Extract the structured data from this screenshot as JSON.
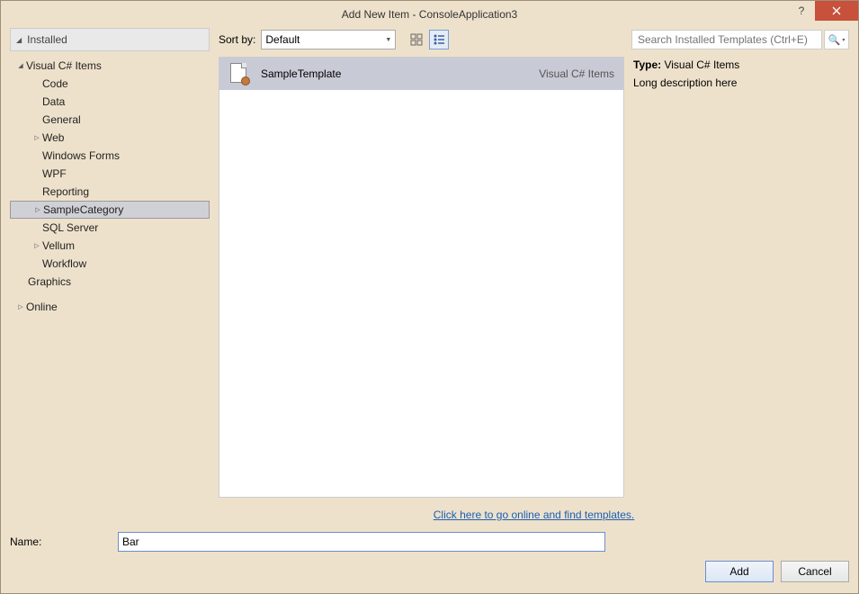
{
  "window": {
    "title": "Add New Item - ConsoleApplication3"
  },
  "sidebar": {
    "header": "Installed",
    "tree": {
      "csItems": "Visual C# Items",
      "code": "Code",
      "data": "Data",
      "general": "General",
      "web": "Web",
      "winforms": "Windows Forms",
      "wpf": "WPF",
      "reporting": "Reporting",
      "sampleCategory": "SampleCategory",
      "sqlServer": "SQL Server",
      "vellum": "Vellum",
      "workflow": "Workflow",
      "graphics": "Graphics",
      "online": "Online"
    }
  },
  "toolbar": {
    "sortByLabel": "Sort by:",
    "sortByValue": "Default",
    "searchPlaceholder": "Search Installed Templates (Ctrl+E)"
  },
  "templates": [
    {
      "name": "SampleTemplate",
      "lang": "Visual C# Items"
    }
  ],
  "details": {
    "typeLabel": "Type:",
    "typeValue": "Visual C# Items",
    "description": "Long description here"
  },
  "onlineLink": "Click here to go online and find templates.",
  "nameField": {
    "label": "Name:",
    "value": "Bar"
  },
  "buttons": {
    "add": "Add",
    "cancel": "Cancel"
  }
}
